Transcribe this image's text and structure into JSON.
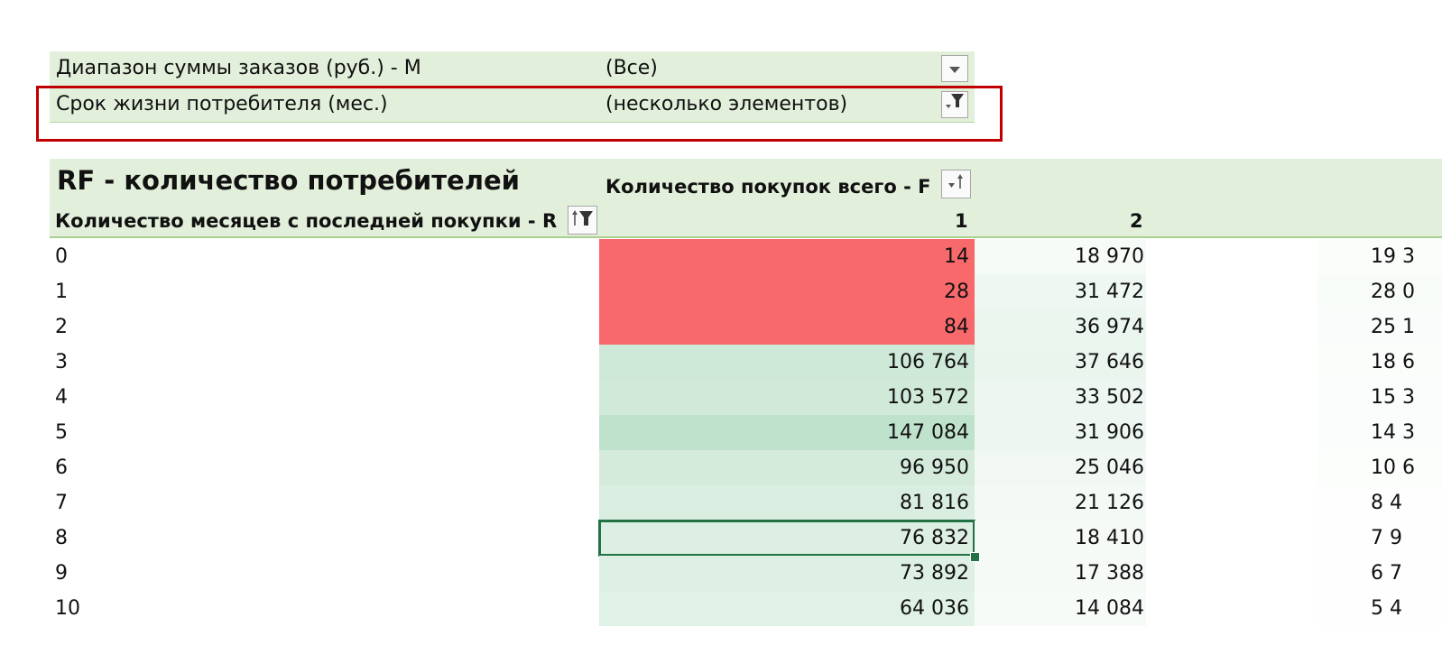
{
  "filters": [
    {
      "label": "Диапазон суммы заказов (руб.) - M",
      "value": "(Все)",
      "icon": "dropdown-arrow-icon"
    },
    {
      "label": "Срок жизни потребителя (мес.)",
      "value": "(несколько элементов)",
      "icon": "filter-applied-icon"
    }
  ],
  "pivot": {
    "title": "RF - количество потребителей",
    "column_field": "Количество покупок всего - F",
    "row_field": "Количество месяцев с последней покупки - R",
    "column_headers": [
      "1",
      "2"
    ],
    "rows": [
      {
        "r": "0",
        "c1": "14",
        "c2": "18 970",
        "c3": "19 3"
      },
      {
        "r": "1",
        "c1": "28",
        "c2": "31 472",
        "c3": "28 0"
      },
      {
        "r": "2",
        "c1": "84",
        "c2": "36 974",
        "c3": "25 1"
      },
      {
        "r": "3",
        "c1": "106 764",
        "c2": "37 646",
        "c3": "18 6"
      },
      {
        "r": "4",
        "c1": "103 572",
        "c2": "33 502",
        "c3": "15 3"
      },
      {
        "r": "5",
        "c1": "147 084",
        "c2": "31 906",
        "c3": "14 3"
      },
      {
        "r": "6",
        "c1": "96 950",
        "c2": "25 046",
        "c3": "10 6"
      },
      {
        "r": "7",
        "c1": "81 816",
        "c2": "21 126",
        "c3": "8 4"
      },
      {
        "r": "8",
        "c1": "76 832",
        "c2": "18 410",
        "c3": "7 9"
      },
      {
        "r": "9",
        "c1": "73 892",
        "c2": "17 388",
        "c3": "6 7"
      },
      {
        "r": "10",
        "c1": "64 036",
        "c2": "14 084",
        "c3": "5 4"
      }
    ]
  },
  "colors": {
    "header_bg": "#e2efda",
    "low_value_red": "#f8696b",
    "selection_green": "#217346",
    "highlight_red": "#c00000"
  },
  "selected_cell": {
    "row": "8",
    "column": "1",
    "value": "76 832"
  }
}
